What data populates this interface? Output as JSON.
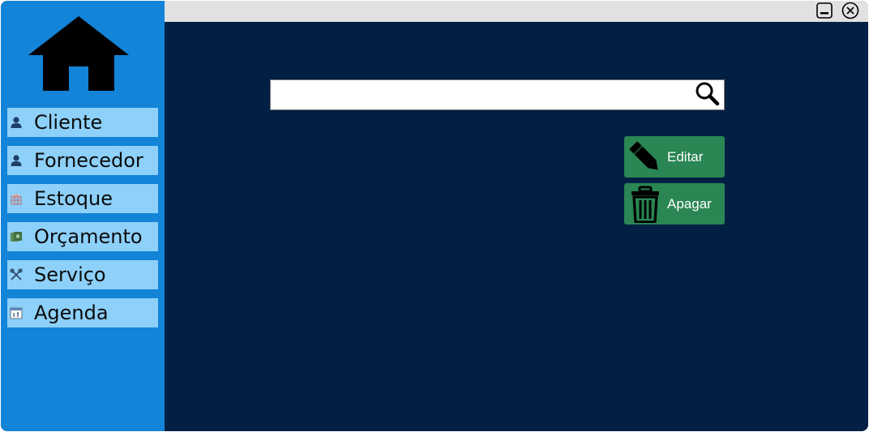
{
  "sidebar": {
    "logo_icon": "home-icon",
    "items": [
      {
        "label": "Cliente",
        "icon": "user-icon"
      },
      {
        "label": "Fornecedor",
        "icon": "user-icon"
      },
      {
        "label": "Estoque",
        "icon": "warehouse-icon"
      },
      {
        "label": "Orçamento",
        "icon": "money-icon"
      },
      {
        "label": "Serviço",
        "icon": "tools-icon"
      },
      {
        "label": "Agenda",
        "icon": "calendar-icon"
      }
    ]
  },
  "titlebar": {
    "minimize_icon": "minimize-icon",
    "close_icon": "close-icon"
  },
  "search": {
    "value": "",
    "placeholder": "",
    "icon": "search-icon"
  },
  "actions": {
    "edit_label": "Editar",
    "delete_label": "Apagar"
  },
  "colors": {
    "sidebar_bg": "#1384d7",
    "menu_item_bg": "#8dd0fa",
    "main_bg": "#022044",
    "button_bg": "#2a8653",
    "titlebar_bg": "#e1e1e1"
  }
}
